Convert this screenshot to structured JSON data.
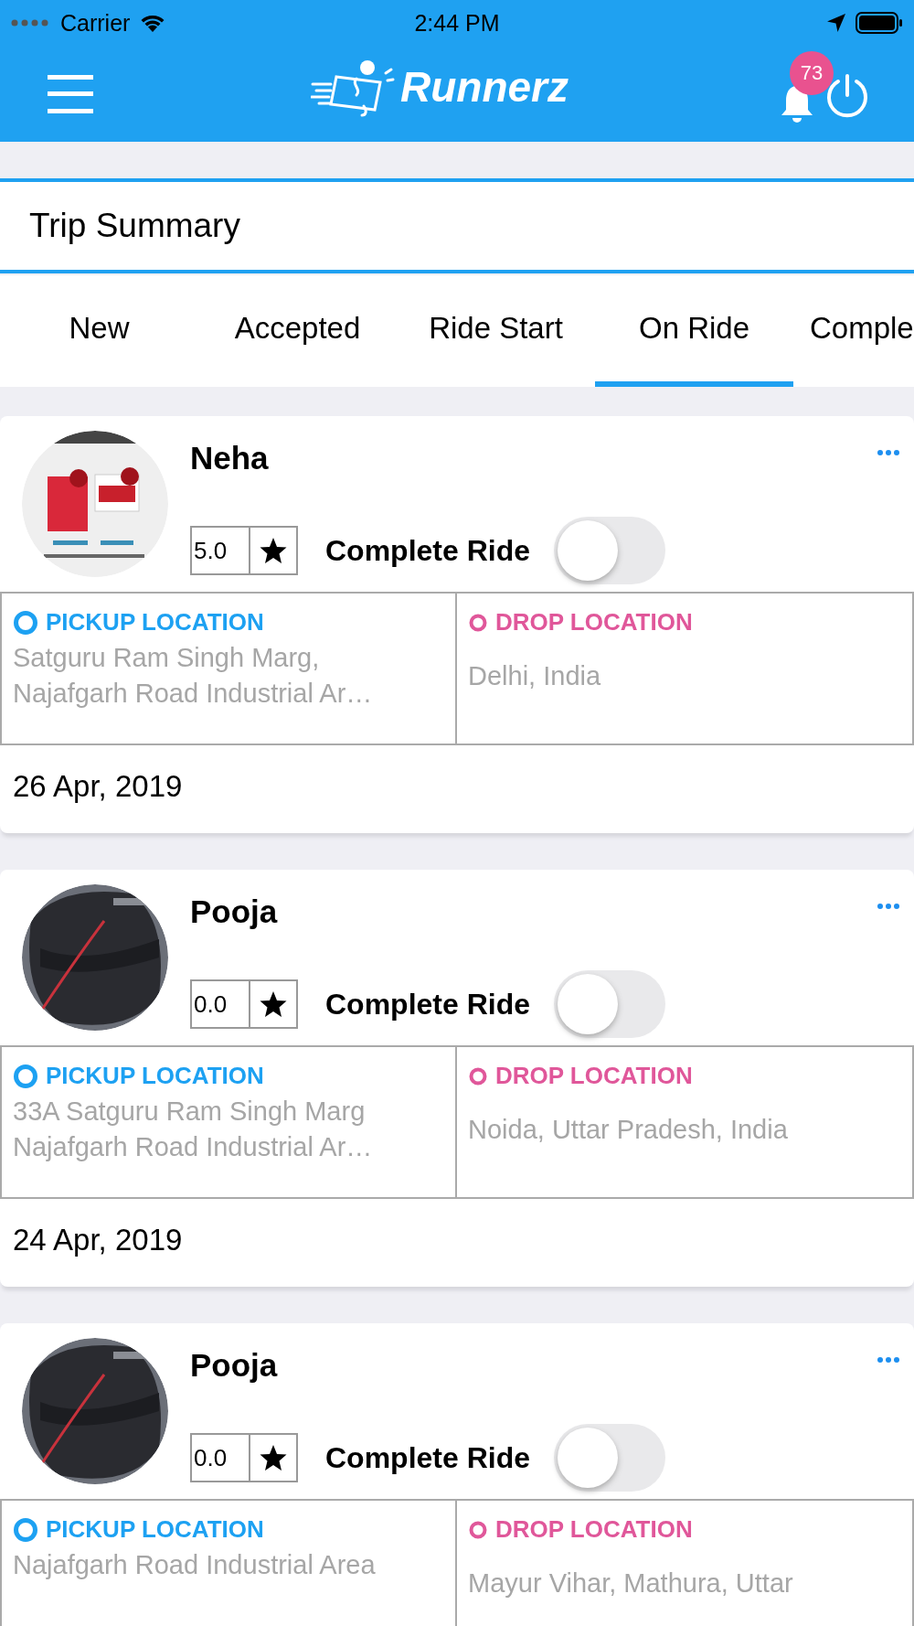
{
  "status_bar": {
    "carrier": "Carrier",
    "time": "2:44 PM"
  },
  "header": {
    "brand": "Runnerz",
    "notifications": "73"
  },
  "page_title": "Trip Summary",
  "tabs": [
    {
      "label": "New",
      "selected": false
    },
    {
      "label": "Accepted",
      "selected": false
    },
    {
      "label": "Ride Start",
      "selected": false
    },
    {
      "label": "On Ride",
      "selected": true
    },
    {
      "label": "Comple",
      "selected": false
    }
  ],
  "trips": [
    {
      "name": "Neha",
      "avatar": {
        "kind": "picture"
      },
      "rating": "5.0",
      "toggle_label": "Complete Ride",
      "on": false,
      "locations": [
        {
          "kind": "pickup",
          "label": "PICKUP LOCATION",
          "address": "Satguru Ram Singh Marg,\nNajafgarh Road Industrial Ar…"
        },
        {
          "kind": "drop",
          "label": "DROP LOCATION",
          "address": "Delhi, India"
        }
      ],
      "date": "26 Apr, 2019"
    },
    {
      "name": "Pooja",
      "avatar": {
        "kind": "picture"
      },
      "rating": "0.0",
      "toggle_label": "Complete Ride",
      "on": false,
      "locations": [
        {
          "kind": "pickup",
          "label": "PICKUP LOCATION",
          "address": "33A Satguru Ram Singh Marg\nNajafgarh Road Industrial Ar…"
        },
        {
          "kind": "drop",
          "label": "DROP LOCATION",
          "address": "Noida, Uttar Pradesh, India"
        }
      ],
      "date": "24 Apr, 2019"
    },
    {
      "name": "Pooja",
      "avatar": {
        "kind": "picture"
      },
      "rating": "0.0",
      "toggle_label": "Complete Ride",
      "on": false,
      "locations": [
        {
          "kind": "pickup",
          "label": "PICKUP LOCATION",
          "address": "Najafgarh Road Industrial Area"
        },
        {
          "kind": "drop",
          "label": "DROP LOCATION",
          "address": "Mayur Vihar, Mathura, Uttar"
        }
      ]
    }
  ]
}
